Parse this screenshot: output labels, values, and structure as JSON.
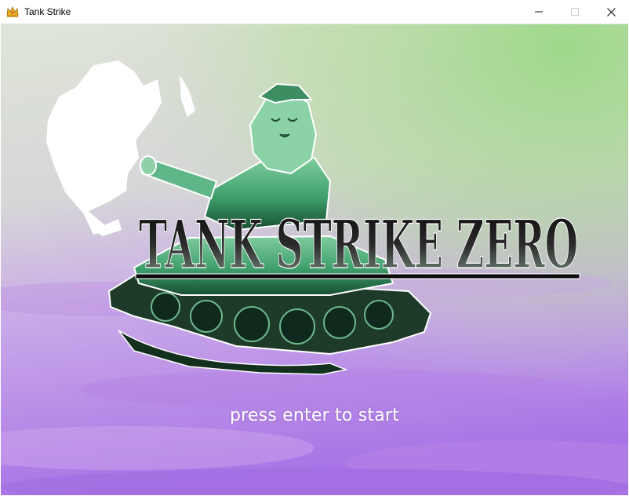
{
  "window": {
    "title": "Tank Strike",
    "icon": "crown-icon",
    "controls": {
      "minimize": "minimize-icon",
      "maximize": "maximize-icon",
      "close": "close-icon"
    }
  },
  "title_screen": {
    "logo_text": "TANK STRIKE ZERO",
    "prompt": "press enter to start"
  },
  "colors": {
    "sky_top": "#a6d98d",
    "sky_mid": "#d9dcd2",
    "sky_bottom": "#b57ee8",
    "logo_green": "#2f9a66",
    "logo_text": "#111111",
    "prompt_text": "#ffffff"
  }
}
